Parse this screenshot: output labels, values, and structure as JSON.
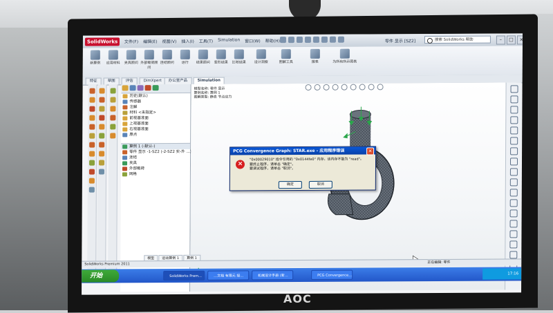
{
  "app": {
    "name": "SolidWorks",
    "menu": [
      "文件(F)",
      "编辑(E)",
      "视图(V)",
      "插入(I)",
      "工具(T)",
      "Simulation",
      "窗口(W)",
      "帮助(H)"
    ],
    "document_title": "零件 显示 [SZ2]",
    "search_placeholder": "搜索 SolidWorks 帮助"
  },
  "commands": [
    {
      "label": "新算例"
    },
    {
      "label": "应用材料"
    },
    {
      "label": "夹具顾问"
    },
    {
      "label": "外部载荷顾问"
    },
    {
      "label": "连结顾问"
    },
    {
      "label": "运行"
    },
    {
      "label": "结果顾问"
    },
    {
      "label": "变形结果"
    },
    {
      "label": "比较结果"
    },
    {
      "label": "设计洞察"
    },
    {
      "label": "图解工具"
    },
    {
      "label": "报表"
    },
    {
      "label": "为所有所示图表"
    }
  ],
  "tabs": [
    "特征",
    "草图",
    "评估",
    "DimXpert",
    "办公室产品",
    "Simulation"
  ],
  "active_tab": "Simulation",
  "tree": {
    "items": [
      {
        "label": "历史(默认)"
      },
      {
        "label": "传感器"
      },
      {
        "label": "注解"
      },
      {
        "label": "材料 <未指定>"
      },
      {
        "label": "前视基准面"
      },
      {
        "label": "上视基准面"
      },
      {
        "label": "右视基准面"
      },
      {
        "label": "原点"
      }
    ],
    "sim_header": "算例 1 (-默认-)",
    "sim_items": [
      {
        "label": "零件 显示 -1-SZ2 (-2-SZ2 实-外 …)"
      },
      {
        "label": "连结"
      },
      {
        "label": "夹具"
      },
      {
        "label": "外部载荷"
      },
      {
        "label": "网格"
      }
    ]
  },
  "graphics": {
    "note": [
      "模型名称: 零件 显示",
      "算例名称: 算例 1",
      "图解类型: 静态 节点应力"
    ]
  },
  "model_tabs": [
    "模型",
    "运动算例 1",
    "算例 1"
  ],
  "status": {
    "left": "SolidWorks Premium 2011",
    "right": "正在编辑: 零件"
  },
  "taskbar": {
    "start": "开始",
    "tasks": [
      {
        "label": "SolidWorks Prem…"
      },
      {
        "label": "…文档 有限元 接…"
      },
      {
        "label": "机械设计手册 (新…"
      },
      {
        "label": "PCG Convergence…"
      }
    ],
    "clock": "17:16"
  },
  "dialog": {
    "title": "PCG Convergence Graph: STAR.exe - 应用程序错误",
    "message": [
      "\"0x00029010\" 指令引用的 \"0x0144fe0\" 内存。该内存不能为 \"read\"。",
      "要终止程序，请单击 \"确定\"。",
      "要调试程序，请单击 \"取消\"。"
    ],
    "ok_label": "确定",
    "cancel_label": "取消",
    "close_glyph": "×",
    "error_glyph": "×"
  },
  "monitor_brand": "AOC",
  "colors": {
    "title_blue": "#0a58d8",
    "error_red": "#d71f1f",
    "mesh_dark": "#2a3038",
    "arrow_green": "#2aa64a",
    "taskbar_blue": "#2357c9",
    "start_green": "#3faa3a"
  }
}
